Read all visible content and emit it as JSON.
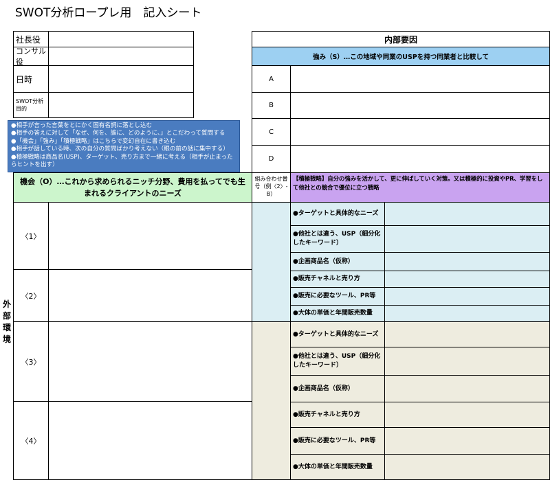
{
  "title": "SWOT分析ロープレ用　記入シート",
  "roles": [
    {
      "label": "社長役"
    },
    {
      "label": "コンサル役"
    },
    {
      "label": "日時"
    },
    {
      "label": "SWOT分析目的"
    }
  ],
  "notes": [
    "●相手が言った言葉をとにかく固有名詞に落とし込む",
    "●相手の答えに対して「なぜ、何を、誰に、どのように、」とこだわって質問する",
    "●「機会」「強み」「積極戦略」はこちらで変幻自在に書き込む",
    "●相手が話している時、次の自分の質問ばかり考えない（眼の前の話に集中する）",
    "●積極戦略は商品名(USP)、ターゲット、売り方まで一緒に考える（相手が止まった",
    "らヒントを出す）"
  ],
  "internal": {
    "header": "内部要因",
    "strength_header": "強み（S）…この地域や同業のUSPを持つ同業者と比較して",
    "letters": [
      "A",
      "B",
      "C",
      "D"
    ]
  },
  "opportunity": {
    "header": "機会（O）…これから求められるニッチ分野、費用を払ってでも生まれるクライアントのニーズ",
    "numbers": [
      "〈1〉",
      "〈2〉",
      "〈3〉",
      "〈4〉"
    ]
  },
  "combo_label": "組み合わせ番号（例〈2〉-B）",
  "strategy_header": "【積極戦略】自分の強みを活かして、更に伸ばしていく対策。又は積極的に投資やPR、学習をして他社との競合で優位に立つ戦略",
  "strategy_items_top": [
    "●ターゲットと具体的なニーズ",
    "●他社とは違う、USP（細分化したキーワード）",
    "●企画商品名（仮称）",
    "●販売チャネルと売り方",
    "●販売に必要なツール、PR等",
    "●大体の単価と年間販売数量"
  ],
  "strategy_items_bottom": [
    "●ターゲットと具体的なニーズ",
    "●他社とは違う、USP（細分化したキーワード）",
    "●企画商品名（仮称）",
    "●販売チャネルと売り方",
    "●販売に必要なツール、PR等",
    "●大体の単価と年間販売数量"
  ],
  "external_label": [
    "外",
    "部",
    "環",
    "境"
  ],
  "colors": {
    "note_bg": "#4a7cc0",
    "strength_bg": "#9dd0f2",
    "opportunity_bg": "#ccf5cc",
    "strategy_bg": "#c9a3f0",
    "blue_rows": "#dbeef3",
    "cream_rows": "#eeecdf"
  }
}
